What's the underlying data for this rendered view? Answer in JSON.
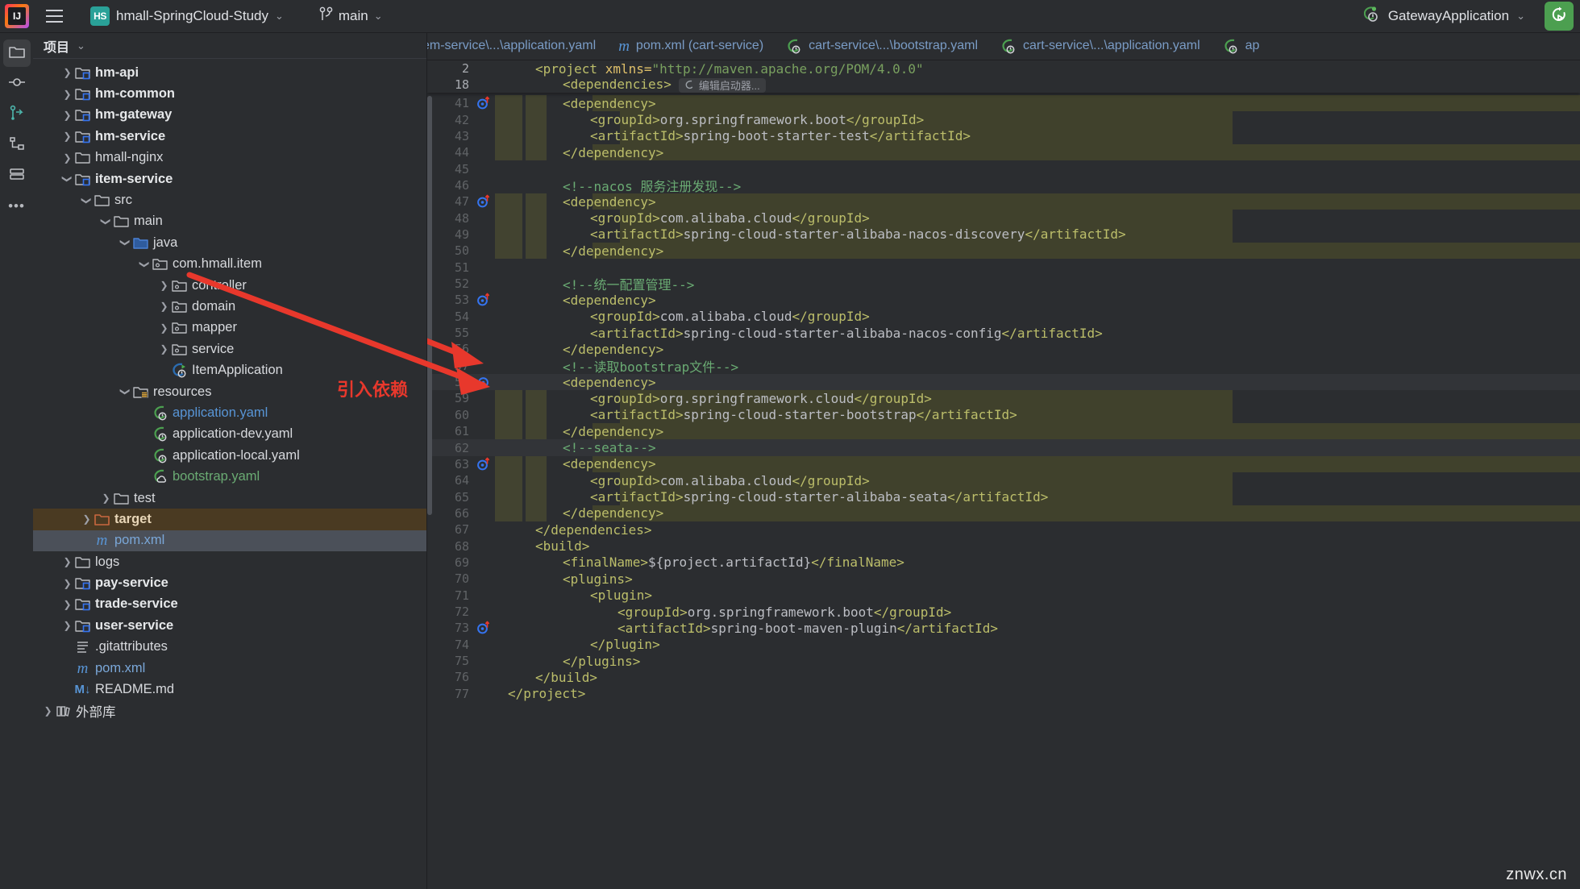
{
  "window": {
    "logo": "intellij-idea-logo",
    "menu_icon": "hamburger-menu-icon",
    "project_badge": "HS",
    "project_name": "hmall-SpringCloud-Study",
    "branch_icon": "git-branch-icon",
    "branch_name": "main",
    "run_config": "GatewayApplication",
    "rerun_icon": "rerun-icon",
    "chevron": "⌄"
  },
  "rail": {
    "items": [
      {
        "name": "project-tool-window",
        "icon": "folder-icon",
        "active": true
      },
      {
        "name": "commit-tool-window",
        "icon": "commit-circle-icon",
        "active": false
      },
      {
        "name": "pull-requests-tool-window",
        "icon": "pull-request-icon",
        "active": false
      },
      {
        "name": "structure-tool-window",
        "icon": "structure-icon",
        "active": false
      },
      {
        "name": "services-tool-window",
        "icon": "services-icon",
        "active": false
      },
      {
        "name": "more-tool-windows",
        "icon": "more-dots-icon",
        "active": false
      }
    ]
  },
  "project_panel": {
    "title": "项目",
    "title_chevron": "⌄",
    "tree": [
      {
        "label": "hm-api",
        "depth": 1,
        "arrow": "collapsed",
        "icon": "module-folder-icon",
        "style": "bold"
      },
      {
        "label": "hm-common",
        "depth": 1,
        "arrow": "collapsed",
        "icon": "module-folder-icon",
        "style": "bold"
      },
      {
        "label": "hm-gateway",
        "depth": 1,
        "arrow": "collapsed",
        "icon": "module-folder-icon",
        "style": "bold"
      },
      {
        "label": "hm-service",
        "depth": 1,
        "arrow": "collapsed",
        "icon": "module-folder-icon",
        "style": "bold"
      },
      {
        "label": "hmall-nginx",
        "depth": 1,
        "arrow": "collapsed",
        "icon": "folder-icon",
        "style": "plain"
      },
      {
        "label": "item-service",
        "depth": 1,
        "arrow": "expanded",
        "icon": "module-folder-icon",
        "style": "bold"
      },
      {
        "label": "src",
        "depth": 2,
        "arrow": "expanded",
        "icon": "folder-icon",
        "style": "plain"
      },
      {
        "label": "main",
        "depth": 3,
        "arrow": "expanded",
        "icon": "folder-icon",
        "style": "plain"
      },
      {
        "label": "java",
        "depth": 4,
        "arrow": "expanded",
        "icon": "source-root-folder-icon",
        "style": "plain"
      },
      {
        "label": "com.hmall.item",
        "depth": 5,
        "arrow": "expanded",
        "icon": "package-folder-icon",
        "style": "plain"
      },
      {
        "label": "controller",
        "depth": 6,
        "arrow": "collapsed",
        "icon": "package-folder-icon",
        "style": "plain"
      },
      {
        "label": "domain",
        "depth": 6,
        "arrow": "collapsed",
        "icon": "package-folder-icon",
        "style": "plain"
      },
      {
        "label": "mapper",
        "depth": 6,
        "arrow": "collapsed",
        "icon": "package-folder-icon",
        "style": "plain"
      },
      {
        "label": "service",
        "depth": 6,
        "arrow": "collapsed",
        "icon": "package-folder-icon",
        "style": "plain"
      },
      {
        "label": "ItemApplication",
        "depth": 6,
        "arrow": "none",
        "icon": "spring-boot-class-icon",
        "style": "plain"
      },
      {
        "label": "resources",
        "depth": 4,
        "arrow": "expanded",
        "icon": "resources-root-folder-icon",
        "style": "plain"
      },
      {
        "label": "application.yaml",
        "depth": 5,
        "arrow": "none",
        "icon": "spring-yaml-icon",
        "style": "blue"
      },
      {
        "label": "application-dev.yaml",
        "depth": 5,
        "arrow": "none",
        "icon": "spring-yaml-icon",
        "style": "plain"
      },
      {
        "label": "application-local.yaml",
        "depth": 5,
        "arrow": "none",
        "icon": "spring-yaml-icon",
        "style": "plain"
      },
      {
        "label": "bootstrap.yaml",
        "depth": 5,
        "arrow": "none",
        "icon": "spring-cloud-yaml-icon",
        "style": "green"
      },
      {
        "label": "test",
        "depth": 3,
        "arrow": "collapsed",
        "icon": "folder-icon",
        "style": "plain"
      },
      {
        "label": "target",
        "depth": 2,
        "arrow": "collapsed",
        "icon": "excluded-folder-icon",
        "style": "excluded",
        "row": "sel-excluded"
      },
      {
        "label": "pom.xml",
        "depth": 2,
        "arrow": "none",
        "icon": "maven-pom-icon",
        "style": "maven-blue",
        "row": "sel-focus"
      },
      {
        "label": "logs",
        "depth": 1,
        "arrow": "collapsed",
        "icon": "folder-icon",
        "style": "plain"
      },
      {
        "label": "pay-service",
        "depth": 1,
        "arrow": "collapsed",
        "icon": "module-folder-icon",
        "style": "bold"
      },
      {
        "label": "trade-service",
        "depth": 1,
        "arrow": "collapsed",
        "icon": "module-folder-icon",
        "style": "bold"
      },
      {
        "label": "user-service",
        "depth": 1,
        "arrow": "collapsed",
        "icon": "module-folder-icon",
        "style": "bold"
      },
      {
        "label": ".gitattributes",
        "depth": 1,
        "arrow": "none",
        "icon": "text-file-icon",
        "style": "plain"
      },
      {
        "label": "pom.xml",
        "depth": 1,
        "arrow": "none",
        "icon": "maven-pom-icon",
        "style": "maven-blue"
      },
      {
        "label": "README.md",
        "depth": 1,
        "arrow": "none",
        "icon": "markdown-file-icon",
        "style": "plain"
      },
      {
        "label": "外部库",
        "depth": 0,
        "arrow": "collapsed",
        "icon": "external-libraries-icon",
        "style": "plain"
      }
    ]
  },
  "editor": {
    "tabs": [
      {
        "label": "em-service\\...\\application.yaml",
        "icon": "spring-yaml-icon",
        "clipped": true,
        "active": false
      },
      {
        "label": "pom.xml (cart-service)",
        "icon": "maven-pom-icon",
        "clipped": false,
        "active": false
      },
      {
        "label": "cart-service\\...\\bootstrap.yaml",
        "icon": "spring-yaml-icon",
        "clipped": false,
        "active": false
      },
      {
        "label": "cart-service\\...\\application.yaml",
        "icon": "spring-yaml-icon",
        "clipped": false,
        "active": false
      },
      {
        "label": "ap",
        "icon": "spring-yaml-icon",
        "clipped": false,
        "active": false
      }
    ],
    "sticky_lines": [
      {
        "num": "2",
        "indent": 1,
        "segments": [
          {
            "t": "<project ",
            "c": "k-tag"
          },
          {
            "t": "xmlns=",
            "c": "k-attr"
          },
          {
            "t": "\"http://maven.apache.org/POM/4.0.0\"",
            "c": "k-str"
          }
        ]
      },
      {
        "num": "18",
        "indent": 2,
        "segments": [
          {
            "t": "<dependencies>",
            "c": "k-tag"
          }
        ],
        "inlay": {
          "icon": "spring-leaf-icon",
          "text": "编辑启动器..."
        }
      }
    ],
    "lines": [
      {
        "num": "41",
        "indent": 2,
        "gutter": "spring-bean-nav-icon",
        "hl": true,
        "segments": [
          {
            "t": "<dependency>",
            "c": "k-tag"
          }
        ]
      },
      {
        "num": "42",
        "indent": 3,
        "hl": true,
        "segments": [
          {
            "t": "<groupId>",
            "c": "k-tag"
          },
          {
            "t": "org.springframework.boot",
            "c": "k-txt"
          },
          {
            "t": "</groupId>",
            "c": "k-tag"
          }
        ]
      },
      {
        "num": "43",
        "indent": 3,
        "hl": true,
        "segments": [
          {
            "t": "<artifactId>",
            "c": "k-tag"
          },
          {
            "t": "spring-boot-starter-test",
            "c": "k-txt"
          },
          {
            "t": "</artifactId>",
            "c": "k-tag"
          }
        ]
      },
      {
        "num": "44",
        "indent": 2,
        "hl": true,
        "segments": [
          {
            "t": "</dependency>",
            "c": "k-tag"
          }
        ]
      },
      {
        "num": "45",
        "indent": 0,
        "segments": []
      },
      {
        "num": "46",
        "indent": 2,
        "segments": [
          {
            "t": "<!--nacos 服务注册发现-->",
            "c": "k-cmt"
          }
        ]
      },
      {
        "num": "47",
        "indent": 2,
        "gutter": "spring-bean-nav-icon",
        "hl": true,
        "segments": [
          {
            "t": "<dependency>",
            "c": "k-tag"
          }
        ]
      },
      {
        "num": "48",
        "indent": 3,
        "hl": true,
        "segments": [
          {
            "t": "<groupId>",
            "c": "k-tag"
          },
          {
            "t": "com.alibaba.cloud",
            "c": "k-txt"
          },
          {
            "t": "</groupId>",
            "c": "k-tag"
          }
        ]
      },
      {
        "num": "49",
        "indent": 3,
        "hl": true,
        "segments": [
          {
            "t": "<artifactId>",
            "c": "k-tag"
          },
          {
            "t": "spring-cloud-starter-alibaba-nacos-discovery",
            "c": "k-txt"
          },
          {
            "t": "</artifactId>",
            "c": "k-tag"
          }
        ]
      },
      {
        "num": "50",
        "indent": 2,
        "hl": true,
        "segments": [
          {
            "t": "</dependency>",
            "c": "k-tag"
          }
        ]
      },
      {
        "num": "51",
        "indent": 0,
        "segments": []
      },
      {
        "num": "52",
        "indent": 2,
        "segments": [
          {
            "t": "<!--统一配置管理-->",
            "c": "k-cmt"
          }
        ]
      },
      {
        "num": "53",
        "indent": 2,
        "gutter": "spring-bean-nav-icon",
        "segments": [
          {
            "t": "<dependency>",
            "c": "k-tag"
          }
        ]
      },
      {
        "num": "54",
        "indent": 3,
        "segments": [
          {
            "t": "<groupId>",
            "c": "k-tag"
          },
          {
            "t": "com.alibaba.cloud",
            "c": "k-txt"
          },
          {
            "t": "</groupId>",
            "c": "k-tag"
          }
        ]
      },
      {
        "num": "55",
        "indent": 3,
        "segments": [
          {
            "t": "<artifactId>",
            "c": "k-tag"
          },
          {
            "t": "spring-cloud-starter-alibaba-nacos-config",
            "c": "k-txt"
          },
          {
            "t": "</artifactId>",
            "c": "k-tag"
          }
        ]
      },
      {
        "num": "56",
        "indent": 2,
        "segments": [
          {
            "t": "</dependency>",
            "c": "k-tag"
          }
        ]
      },
      {
        "num": "57",
        "indent": 2,
        "segments": [
          {
            "t": "<!--读取bootstrap文件-->",
            "c": "k-cmt"
          }
        ]
      },
      {
        "num": "58",
        "indent": 2,
        "gutter": "spring-bean-nav-plain-icon",
        "hl": true,
        "caret": true,
        "segments": [
          {
            "t": "<dependency>",
            "c": "k-tag"
          }
        ]
      },
      {
        "num": "59",
        "indent": 3,
        "hl": true,
        "segments": [
          {
            "t": "<groupId>",
            "c": "k-tag"
          },
          {
            "t": "org.springframework.cloud",
            "c": "k-txt"
          },
          {
            "t": "</groupId>",
            "c": "k-tag"
          }
        ]
      },
      {
        "num": "60",
        "indent": 3,
        "hl": true,
        "segments": [
          {
            "t": "<artifactId>",
            "c": "k-tag"
          },
          {
            "t": "spring-cloud-starter-bootstrap",
            "c": "k-txt"
          },
          {
            "t": "</artifactId>",
            "c": "k-tag"
          }
        ]
      },
      {
        "num": "61",
        "indent": 2,
        "hl": true,
        "segments": [
          {
            "t": "</dependency>",
            "c": "k-tag"
          }
        ]
      },
      {
        "num": "62",
        "indent": 2,
        "caret": true,
        "segments": [
          {
            "t": "<!--seata-->",
            "c": "k-cmt"
          }
        ]
      },
      {
        "num": "63",
        "indent": 2,
        "gutter": "spring-bean-nav-icon",
        "hl": true,
        "segments": [
          {
            "t": "<dependency>",
            "c": "k-tag"
          }
        ]
      },
      {
        "num": "64",
        "indent": 3,
        "hl": true,
        "segments": [
          {
            "t": "<groupId>",
            "c": "k-tag"
          },
          {
            "t": "com.alibaba.cloud",
            "c": "k-txt"
          },
          {
            "t": "</groupId>",
            "c": "k-tag"
          }
        ]
      },
      {
        "num": "65",
        "indent": 3,
        "hl": true,
        "segments": [
          {
            "t": "<artifactId>",
            "c": "k-tag"
          },
          {
            "t": "spring-cloud-starter-alibaba-seata",
            "c": "k-txt"
          },
          {
            "t": "</artifactId>",
            "c": "k-tag"
          }
        ]
      },
      {
        "num": "66",
        "indent": 2,
        "hl": true,
        "segments": [
          {
            "t": "</dependency>",
            "c": "k-tag"
          }
        ]
      },
      {
        "num": "67",
        "indent": 1,
        "segments": [
          {
            "t": "</dependencies>",
            "c": "k-tag"
          }
        ]
      },
      {
        "num": "68",
        "indent": 1,
        "segments": [
          {
            "t": "<build>",
            "c": "k-tag"
          }
        ]
      },
      {
        "num": "69",
        "indent": 2,
        "segments": [
          {
            "t": "<finalName>",
            "c": "k-tag"
          },
          {
            "t": "${project.artifactId}",
            "c": "k-txt"
          },
          {
            "t": "</finalName>",
            "c": "k-tag"
          }
        ]
      },
      {
        "num": "70",
        "indent": 2,
        "segments": [
          {
            "t": "<plugins>",
            "c": "k-tag"
          }
        ]
      },
      {
        "num": "71",
        "indent": 3,
        "segments": [
          {
            "t": "<plugin>",
            "c": "k-tag"
          }
        ]
      },
      {
        "num": "72",
        "indent": 4,
        "segments": [
          {
            "t": "<groupId>",
            "c": "k-tag"
          },
          {
            "t": "org.springframework.boot",
            "c": "k-txt"
          },
          {
            "t": "</groupId>",
            "c": "k-tag"
          }
        ]
      },
      {
        "num": "73",
        "indent": 4,
        "gutter": "spring-bean-nav-icon",
        "segments": [
          {
            "t": "<artifactId>",
            "c": "k-tag"
          },
          {
            "t": "spring-boot-maven-plugin",
            "c": "k-txt"
          },
          {
            "t": "</artifactId>",
            "c": "k-tag"
          }
        ]
      },
      {
        "num": "74",
        "indent": 3,
        "segments": [
          {
            "t": "</plugin>",
            "c": "k-tag"
          }
        ]
      },
      {
        "num": "75",
        "indent": 2,
        "segments": [
          {
            "t": "</plugins>",
            "c": "k-tag"
          }
        ]
      },
      {
        "num": "76",
        "indent": 1,
        "segments": [
          {
            "t": "</build>",
            "c": "k-tag"
          }
        ]
      },
      {
        "num": "77",
        "indent": 0,
        "segments": [
          {
            "t": "</project>",
            "c": "k-tag"
          }
        ]
      }
    ]
  },
  "annotation": {
    "label": "引入依赖",
    "color": "#e8382c"
  },
  "watermark": "znwx.cn",
  "colors": {
    "background": "#2b2d30",
    "editor_bg": "#2b2d30",
    "accent_green": "#4c9f50",
    "tab_text": "#7a9cc6",
    "highlight_band": "#5c5c28",
    "excluded_row": "#4a3a22",
    "selected_row": "#4b5059",
    "annotation_red": "#e8382c"
  }
}
